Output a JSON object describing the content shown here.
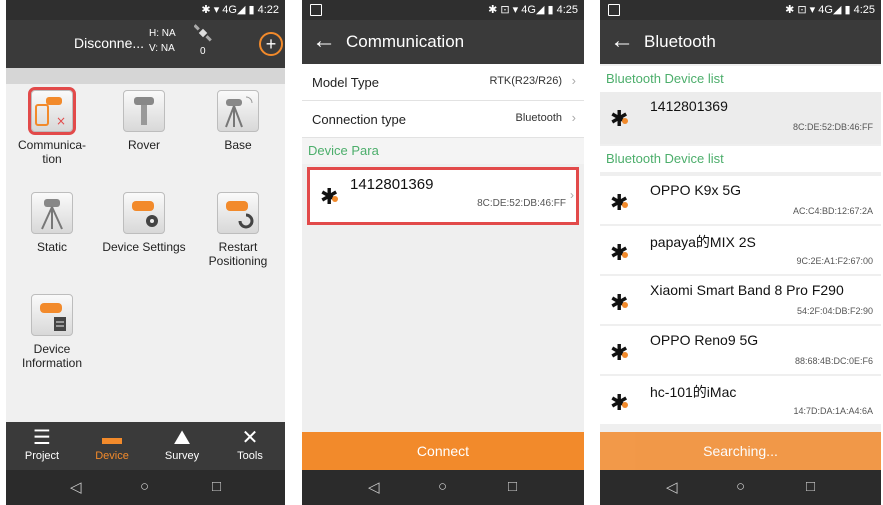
{
  "phone1": {
    "status_time": "4:22",
    "status_icons": "✱ ▾ 4G◢ ▮",
    "connection": "Disconne...",
    "h": "H: NA",
    "v": "V: NA",
    "sat_count": "0",
    "plus_symbol": "+",
    "tiles": [
      {
        "label": "Communica-\ntion"
      },
      {
        "label": "Rover"
      },
      {
        "label": "Base"
      },
      {
        "label": "Static"
      },
      {
        "label": "Device Settings"
      },
      {
        "label": "Restart\nPositioning"
      },
      {
        "label": "Device\nInformation"
      }
    ],
    "nav": [
      {
        "label": "Project"
      },
      {
        "label": "Device"
      },
      {
        "label": "Survey"
      },
      {
        "label": "Tools"
      }
    ]
  },
  "phone2": {
    "status_time": "4:25",
    "status_icons": "✱ ⊡ ▾ 4G◢ ▮",
    "title": "Communication",
    "model_type_label": "Model Type",
    "model_type_value": "RTK(R23/R26)",
    "connection_type_label": "Connection type",
    "connection_type_value": "Bluetooth",
    "device_para": "Device Para",
    "device_name": "1412801369",
    "device_mac": "8C:DE:52:DB:46:FF",
    "connect": "Connect"
  },
  "phone3": {
    "status_time": "4:25",
    "status_icons": "✱ ⊡ ▾ 4G◢ ▮",
    "title": "Bluetooth",
    "list_header_1": "Bluetooth Device list",
    "list_header_2": "Bluetooth Device list",
    "paired": {
      "name": "1412801369",
      "mac": "8C:DE:52:DB:46:FF"
    },
    "devices": [
      {
        "name": "OPPO K9x 5G",
        "mac": "AC:C4:BD:12:67:2A"
      },
      {
        "name": "papaya的MIX 2S",
        "mac": "9C:2E:A1:F2:67:00"
      },
      {
        "name": "Xiaomi Smart Band 8 Pro F290",
        "mac": "54:2F:04:DB:F2:90"
      },
      {
        "name": "OPPO Reno9 5G",
        "mac": "88:68:4B:DC:0E:F6"
      },
      {
        "name": "hc-101的iMac",
        "mac": "14:7D:DA:1A:A4:6A"
      }
    ],
    "searching": "Searching..."
  },
  "sysnav": {
    "back": "◁",
    "home": "○",
    "recent": "□"
  },
  "colors": {
    "accent": "#f28a2b",
    "section_green": "#4cae6b",
    "highlight": "#e24a4a",
    "bar": "#3a3a3a"
  }
}
